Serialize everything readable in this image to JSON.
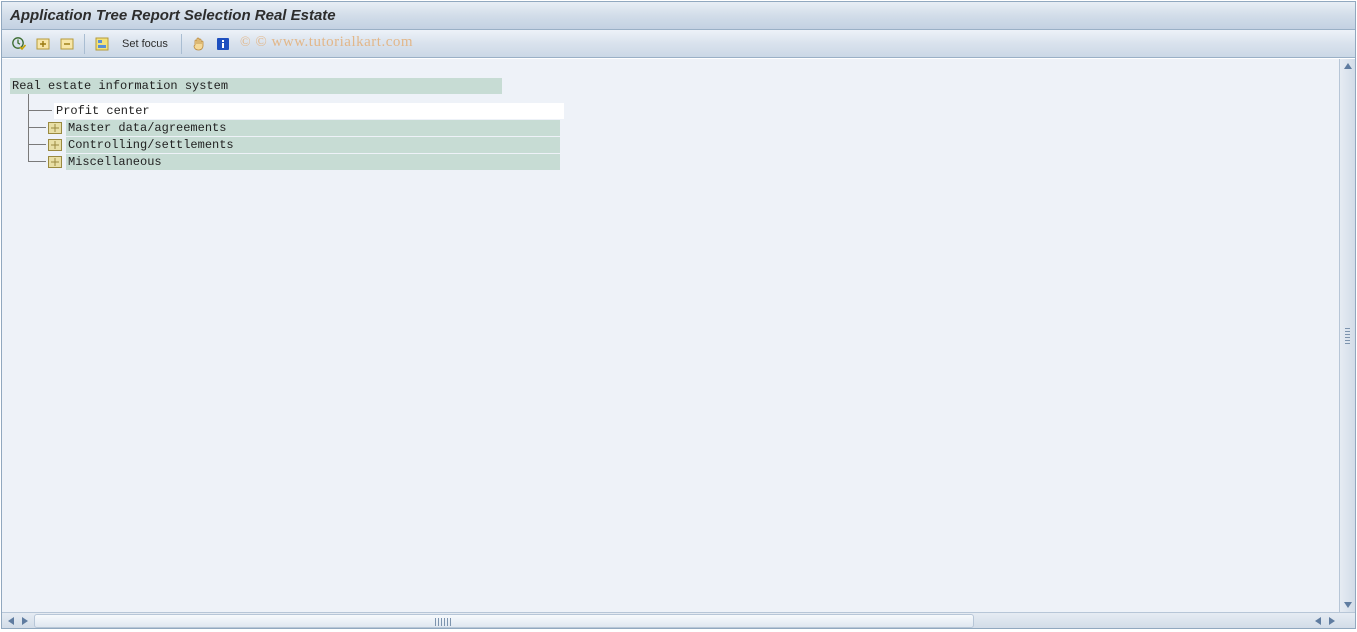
{
  "header": {
    "title": "Application Tree Report Selection Real Estate"
  },
  "toolbar": {
    "execute": "execute-icon",
    "expand": "expand-icon",
    "collapse": "collapse-icon",
    "layout": "layout-icon",
    "set_focus_label": "Set focus",
    "print": "print-icon",
    "info": "info-icon"
  },
  "tree": {
    "root": "Real estate information system",
    "children": [
      {
        "label": "Profit center",
        "folder": false
      },
      {
        "label": "Master data/agreements",
        "folder": true
      },
      {
        "label": "Controlling/settlements",
        "folder": true
      },
      {
        "label": "Miscellaneous",
        "folder": true
      }
    ]
  },
  "watermark": "© www.tutorialkart.com"
}
